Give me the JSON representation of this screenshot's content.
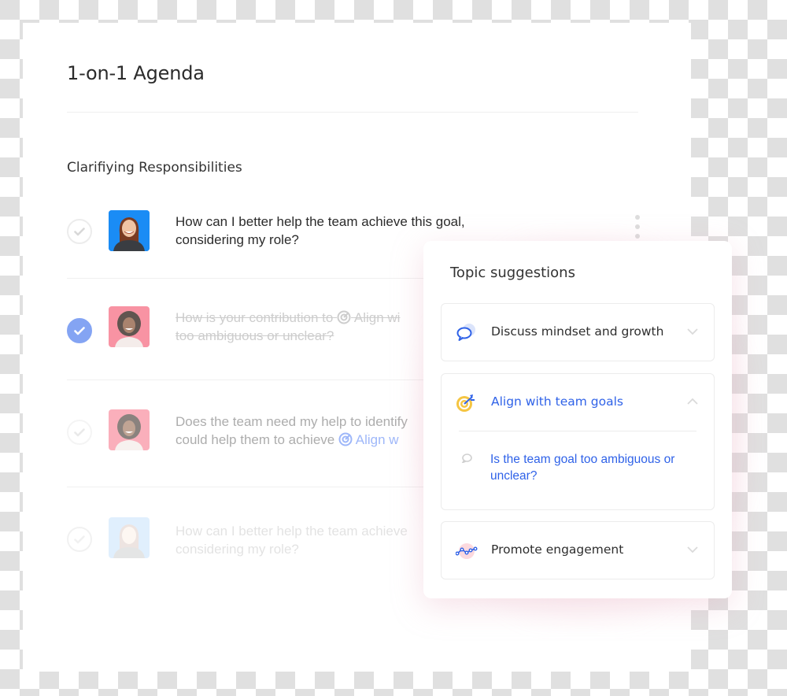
{
  "agenda": {
    "title": "1-on-1 Agenda",
    "section_title": "Clarifiying Responsibilities",
    "items": [
      {
        "text": "How can I better help the team achieve this goal, considering my role?",
        "completed": false,
        "avatar": "woman-blue-background"
      },
      {
        "text_before": "How is your contribution to",
        "chip": "Align wi",
        "text_after": "too ambiguous or unclear?",
        "completed": true,
        "avatar": "woman-pink-background"
      },
      {
        "text_line1": "Does the team need my help to identify",
        "text_line2": "could help them to achieve",
        "chip": "Align w",
        "completed": false,
        "avatar": "woman-pink-background"
      },
      {
        "text": "How can I better help the team achieve considering my role?",
        "completed": false,
        "avatar": "woman-blue-background"
      }
    ]
  },
  "topic_suggestions": {
    "title": "Topic suggestions",
    "topics": [
      {
        "label": "Discuss mindset and growth",
        "icon": "speech-bubble-icon",
        "expanded": false
      },
      {
        "label": "Align with team goals",
        "icon": "target-icon",
        "expanded": true,
        "questions": [
          "Is the team goal too ambiguous or unclear?"
        ]
      },
      {
        "label": "Promote engagement",
        "icon": "trend-line-icon",
        "expanded": false
      }
    ]
  },
  "colors": {
    "accent_blue": "#2f62e8",
    "check_blue": "#5b86f0",
    "target_yellow": "#f5c542"
  }
}
